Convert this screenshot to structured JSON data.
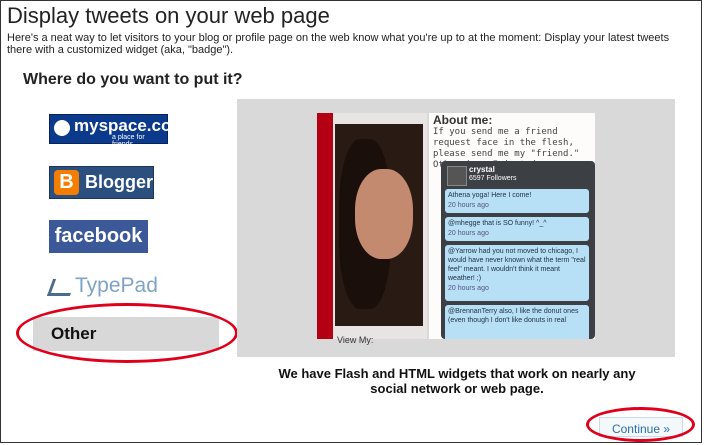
{
  "page": {
    "title": "Display tweets on your web page",
    "intro": "Here's a neat way to let visitors to your blog or profile page on the web know what you're up to at the moment: Display your latest tweets there with a customized widget (aka, \"badge\").",
    "question": "Where do you want to put it?"
  },
  "options": {
    "myspace": {
      "name": "myspace.com",
      "tagline": "a place for friends",
      "icon": "myspace-people-icon",
      "color": "#0b3a8c"
    },
    "blogger": {
      "name": "Blogger",
      "icon_letter": "B",
      "icon": "blogger-b-icon",
      "color": "#f57d00"
    },
    "facebook": {
      "name": "facebook",
      "color": "#3b5998"
    },
    "typepad": {
      "name": "TypePad",
      "icon": "typepad-mark-icon",
      "color": "#7fa3c4"
    },
    "other": {
      "name": "Other"
    }
  },
  "preview": {
    "about_title": "About me:",
    "about_text": "If you send me a friend request face in the flesh, please send me my \"friend.\" Otherwise, I just do",
    "view_my": "View My:",
    "widget": {
      "user": "crystal",
      "followers": "6597 Followers",
      "tweets": [
        {
          "text": "Athena yoga! Here I come!",
          "ago": "20 hours ago"
        },
        {
          "text": "@mhegge that is SO funny! ^_^",
          "ago": "20 hours ago"
        },
        {
          "text": "@Yarrow had you not moved to chicago, I would have never known what the term \"real feel\" meant. I wouldn't think it meant weather! ;)",
          "ago": "20 hours ago"
        },
        {
          "text": "@BrennanTerry also, I like the donut ones (even though I don't like donuts in real",
          "ago": ""
        }
      ]
    }
  },
  "caption": "We have Flash and HTML widgets that work on nearly any social network or web page.",
  "continue_label": "Continue »",
  "highlight_color": "#e0001b"
}
